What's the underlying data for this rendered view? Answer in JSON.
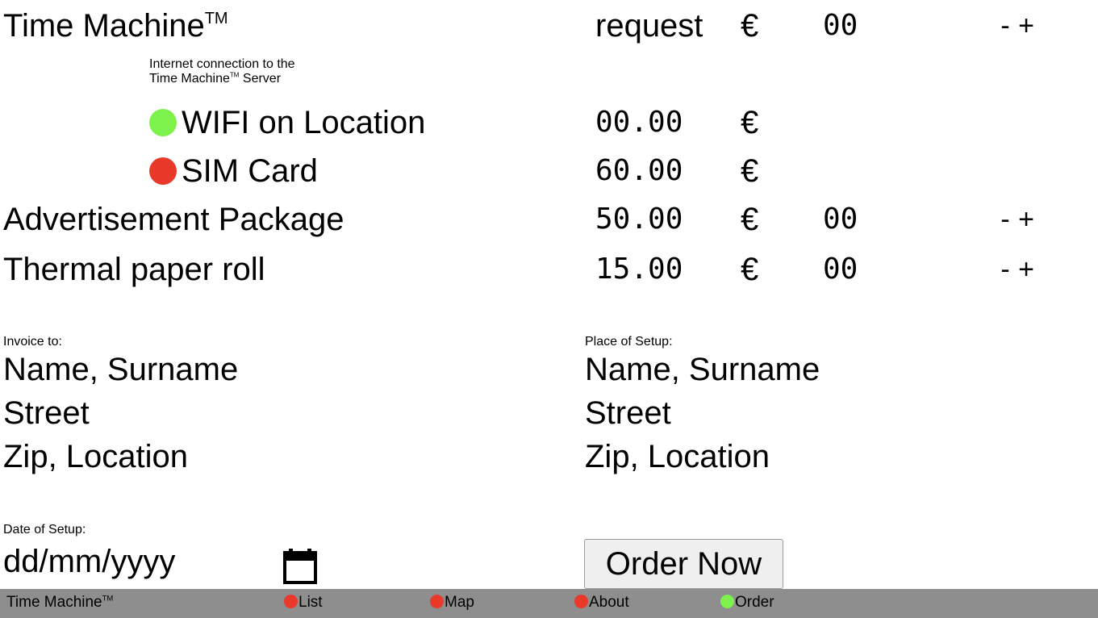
{
  "product": {
    "title": "Time Machine",
    "tm": "TM",
    "price_label": "request",
    "currency": "€",
    "quantity": "00",
    "minus": "-",
    "plus": "+"
  },
  "connection": {
    "caption_line1": "Internet connection to the",
    "caption_line2": "Time Machine",
    "caption_tm": "TM",
    "caption_line2_suffix": " Server",
    "options": [
      {
        "label": "WIFI on Location",
        "price": "00.00",
        "currency": "€",
        "color": "#7ef24c",
        "selected": true
      },
      {
        "label": "SIM Card",
        "price": "60.00",
        "currency": "€",
        "color": "#e8392b",
        "selected": false
      }
    ]
  },
  "addons": [
    {
      "label": "Advertisement Package",
      "price": "50.00",
      "currency": "€",
      "quantity": "00",
      "minus": "-",
      "plus": "+"
    },
    {
      "label": "Thermal paper roll",
      "price": "15.00",
      "currency": "€",
      "quantity": "00",
      "minus": "-",
      "plus": "+"
    }
  ],
  "invoice": {
    "heading": "Invoice to:",
    "name_placeholder": "Name, Surname",
    "street_placeholder": "Street",
    "zip_placeholder": "Zip, Location"
  },
  "setup_place": {
    "heading": "Place of Setup:",
    "name_placeholder": "Name, Surname",
    "street_placeholder": "Street",
    "zip_placeholder": "Zip, Location"
  },
  "date": {
    "heading": "Date of Setup:",
    "placeholder": "dd/mm/yyyy",
    "icon": "calendar-icon"
  },
  "order_button": "Order Now",
  "footer": {
    "brand": "Time Machine",
    "brand_tm": "TM",
    "nav": [
      {
        "label": "List",
        "color": "#e8392b"
      },
      {
        "label": "Map",
        "color": "#e8392b"
      },
      {
        "label": "About",
        "color": "#e8392b"
      },
      {
        "label": "Order",
        "color": "#7ef24c"
      }
    ]
  }
}
